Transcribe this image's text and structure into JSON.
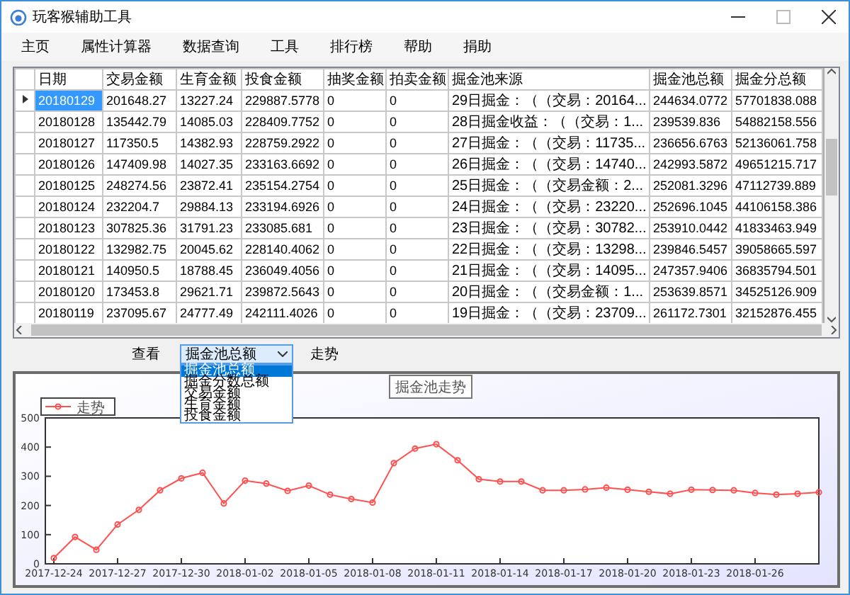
{
  "window": {
    "title": "玩客猴辅助工具"
  },
  "menu": [
    {
      "label": "主页"
    },
    {
      "label": "属性计算器"
    },
    {
      "label": "数据查询"
    },
    {
      "label": "工具"
    },
    {
      "label": "排行榜"
    },
    {
      "label": "帮助"
    },
    {
      "label": "捐助"
    }
  ],
  "table": {
    "columns": [
      "日期",
      "交易金额",
      "生育金额",
      "投食金额",
      "抽奖金额",
      "拍卖金额",
      "掘金池来源",
      "掘金池总额",
      "掘金分总额"
    ],
    "rows": [
      {
        "selected": true,
        "cells": [
          "20180129",
          "201648.27",
          "13227.24",
          "229887.5778",
          "0",
          "0",
          "29日掘金：（（交易：20164...",
          "244634.0772",
          "57701838.088"
        ]
      },
      {
        "selected": false,
        "cells": [
          "20180128",
          "135442.79",
          "14085.03",
          "228409.7752",
          "0",
          "0",
          "28日掘金收益：（（交易：1...",
          "239539.836",
          "54882158.556"
        ]
      },
      {
        "selected": false,
        "cells": [
          "20180127",
          "117350.5",
          "14382.93",
          "228759.2922",
          "0",
          "0",
          "27日掘金：（（交易：11735...",
          "236656.6763",
          "52136061.758"
        ]
      },
      {
        "selected": false,
        "cells": [
          "20180126",
          "147409.98",
          "14027.35",
          "233163.6692",
          "0",
          "0",
          "26日掘金：（（交易：14740...",
          "242993.5872",
          "49651215.717"
        ]
      },
      {
        "selected": false,
        "cells": [
          "20180125",
          "248274.56",
          "23872.41",
          "235154.2754",
          "0",
          "0",
          "25日掘金：（（交易金额：2...",
          "252081.3296",
          "47112739.889"
        ]
      },
      {
        "selected": false,
        "cells": [
          "20180124",
          "232204.7",
          "29884.13",
          "233194.6926",
          "0",
          "0",
          "24日掘金：（（交易：23220...",
          "252696.1045",
          "44106158.386"
        ]
      },
      {
        "selected": false,
        "cells": [
          "20180123",
          "307825.36",
          "31791.23",
          "233085.681",
          "0",
          "0",
          "23日掘金：（（交易：30782...",
          "253910.0442",
          "41833463.949"
        ]
      },
      {
        "selected": false,
        "cells": [
          "20180122",
          "132982.75",
          "20045.62",
          "228140.4062",
          "0",
          "0",
          "22日掘金：（（交易：13298...",
          "239846.5457",
          "39058665.597"
        ]
      },
      {
        "selected": false,
        "cells": [
          "20180121",
          "140950.5",
          "18788.45",
          "236049.4056",
          "0",
          "0",
          "21日掘金：（（交易：14095...",
          "247357.9406",
          "36835794.501"
        ]
      },
      {
        "selected": false,
        "cells": [
          "20180120",
          "173453.8",
          "29621.71",
          "239872.5643",
          "0",
          "0",
          "20日掘金：（（交易金额：1...",
          "253639.8571",
          "34525126.909"
        ]
      },
      {
        "selected": false,
        "cells": [
          "20180119",
          "237095.67",
          "24777.49",
          "242111.4026",
          "0",
          "0",
          "19日掘金：（（交易：23709...",
          "261172.7301",
          "32152876.455"
        ]
      }
    ]
  },
  "view": {
    "label": "查看",
    "select": {
      "value": "掘金池总额",
      "expanded": true,
      "options": [
        {
          "label": "掘金池总额",
          "selected": true
        },
        {
          "label": "掘金分数总额",
          "selected": false
        },
        {
          "label": "交易金额",
          "selected": false
        },
        {
          "label": "生育金额",
          "selected": false
        },
        {
          "label": "投食金额",
          "selected": false
        }
      ]
    },
    "trend_label": "走势"
  },
  "chart": {
    "chart_data": {
      "type": "line",
      "title": "掘金池走势",
      "categories": [
        "2017-12-24",
        null,
        null,
        "2017-12-27",
        null,
        null,
        "2017-12-30",
        null,
        null,
        "2018-01-02",
        null,
        null,
        "2018-01-05",
        null,
        null,
        "2018-01-08",
        null,
        null,
        "2018-01-11",
        null,
        null,
        "2018-01-14",
        null,
        null,
        "2018-01-17",
        null,
        null,
        "2018-01-20",
        null,
        null,
        "2018-01-23",
        null,
        null,
        "2018-01-26",
        null,
        null,
        null
      ],
      "series": [
        {
          "name": "走势",
          "color": "#ff5050",
          "marker": "circle",
          "values": [
            20,
            92,
            48,
            135,
            185,
            252,
            293,
            312,
            207,
            285,
            275,
            250,
            268,
            237,
            222,
            210,
            345,
            395,
            410,
            355,
            290,
            282,
            282,
            252,
            252,
            255,
            261,
            254,
            247,
            240,
            254,
            253,
            252,
            243,
            237,
            240,
            245
          ]
        }
      ],
      "ylim": [
        0,
        500
      ],
      "yticks": [
        0,
        100,
        200,
        300,
        400,
        500
      ]
    }
  }
}
